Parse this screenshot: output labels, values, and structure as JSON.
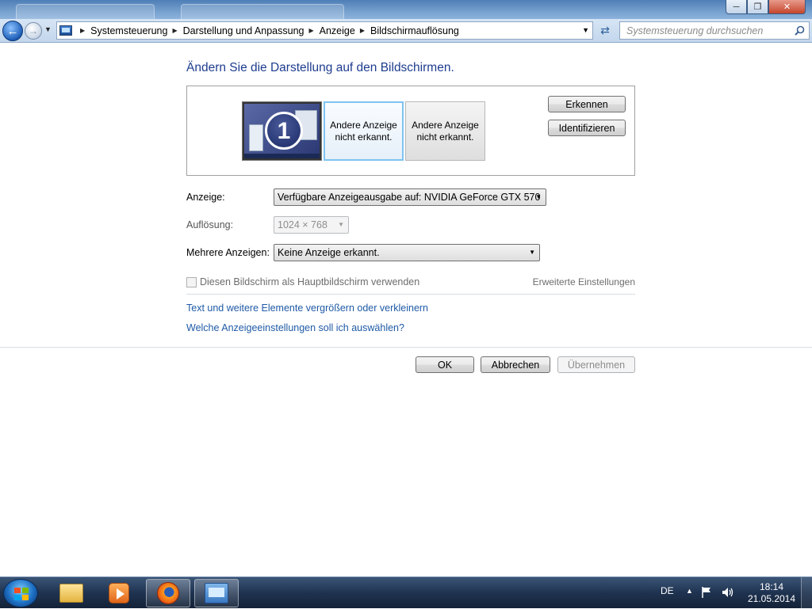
{
  "address_bar": {
    "breadcrumbs": [
      "Systemsteuerung",
      "Darstellung und Anpassung",
      "Anzeige",
      "Bildschirmauflösung"
    ],
    "search_placeholder": "Systemsteuerung durchsuchen"
  },
  "main": {
    "heading": "Ändern Sie die Darstellung auf den Bildschirmen.",
    "monitors": [
      {
        "number": "1",
        "text": ""
      },
      {
        "text": "Andere Anzeige nicht erkannt."
      },
      {
        "text": "Andere Anzeige nicht erkannt."
      }
    ],
    "detect_button": "Erkennen",
    "identify_button": "Identifizieren",
    "display_label": "Anzeige:",
    "display_value": "Verfügbare Anzeigeausgabe auf: NVIDIA GeForce GTX 570",
    "resolution_label": "Auflösung:",
    "resolution_value": "1024 × 768",
    "multiple_label": "Mehrere Anzeigen:",
    "multiple_value": "Keine Anzeige erkannt.",
    "primary_checkbox_label": "Diesen Bildschirm als Hauptbildschirm verwenden",
    "advanced_link": "Erweiterte Einstellungen",
    "link_resize_text": "Text und weitere Elemente vergrößern oder verkleinern",
    "link_which_settings": "Welche Anzeigeeinstellungen soll ich auswählen?"
  },
  "footer": {
    "ok": "OK",
    "cancel": "Abbrechen",
    "apply": "Übernehmen"
  },
  "taskbar": {
    "language": "DE",
    "time": "18:14",
    "date": "21.05.2014",
    "pinned": [
      "folder-icon",
      "media-player-icon",
      "firefox-icon",
      "control-panel-icon"
    ]
  },
  "colors": {
    "heading": "#1e3d8f",
    "link": "#1f5aa6",
    "selected_monitor_border": "#7fc3f1"
  }
}
